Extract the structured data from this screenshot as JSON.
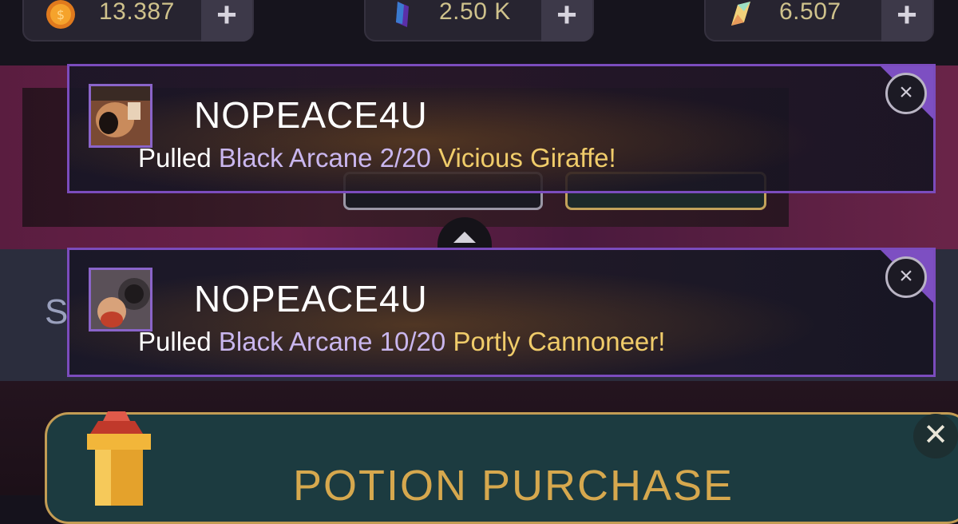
{
  "currency": [
    {
      "icon": "gold-coin-icon",
      "value": "13.387",
      "add_label": "+"
    },
    {
      "icon": "purple-gem-icon",
      "value": "2.50 K",
      "add_label": "+"
    },
    {
      "icon": "crystal-shard-icon",
      "value": "6.507",
      "add_label": "+"
    }
  ],
  "background": {
    "partial_letter": "S"
  },
  "notifications": [
    {
      "player": "NOPEACE4U",
      "prefix": "Pulled",
      "rarity": "Black Arcane",
      "level": "2/20",
      "hero": "Vicious Giraffe!",
      "avatar_icon": "giraffe-avatar-icon",
      "close_label": "×"
    },
    {
      "player": "NOPEACE4U",
      "prefix": "Pulled",
      "rarity": "Black Arcane",
      "level": "10/20",
      "hero": "Portly Cannoneer!",
      "avatar_icon": "cannoneer-avatar-icon",
      "close_label": "×"
    }
  ],
  "potion_panel": {
    "title": "POTION PURCHASE",
    "icon": "potion-bottle-icon",
    "close_label": "✕"
  },
  "colors": {
    "toast_border": "#7b4cbd",
    "rarity_text": "#c9b6ee",
    "hero_text": "#f0cc6a",
    "currency_text": "#cfc28c",
    "potion_title": "#d6a84e"
  }
}
